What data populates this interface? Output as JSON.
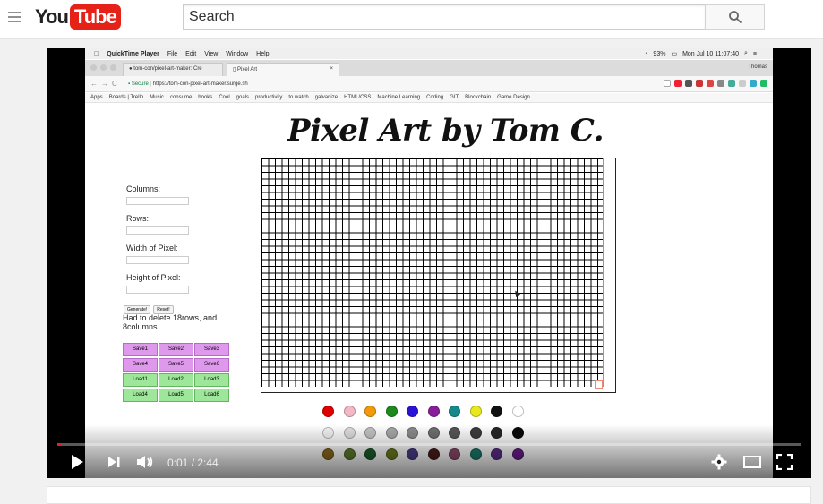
{
  "masthead": {
    "logo_you": "You",
    "logo_tube": "Tube",
    "search_placeholder": "Search"
  },
  "video": {
    "mac_menubar": {
      "app": "QuickTime Player",
      "items": [
        "File",
        "Edit",
        "View",
        "Window",
        "Help"
      ],
      "battery": "93%",
      "clock": "Mon Jul 10  11:07:40"
    },
    "browser": {
      "tab1": "tom-con/pixel-art-maker: Cre",
      "tab2": "Pixel Art",
      "user": "Thomas",
      "secure_label": "Secure",
      "url": "https://tom-con-pixel-art-maker.surge.sh",
      "bookmarks": [
        "Apps",
        "Boards | Trello",
        "Music",
        "consume",
        "books",
        "Cool",
        "goals",
        "productivity",
        "to watch",
        "galvanize",
        "HTML/CSS",
        "Machine Learning",
        "Coding",
        "GIT",
        "Blockchain",
        "Game Design"
      ]
    },
    "page": {
      "title": "Pixel Art by Tom C.",
      "labels": {
        "columns": "Columns:",
        "rows": "Rows:",
        "width": "Width of Pixel:",
        "height": "Height of Pixel:"
      },
      "generate": "Generate!",
      "reset": "Reset!",
      "note": "Had to delete 18rows, and 8columns.",
      "save_buttons": [
        "Save1",
        "Save2",
        "Save3",
        "Save4",
        "Save5",
        "Save6"
      ],
      "load_buttons": [
        "Load1",
        "Load2",
        "Load3",
        "Load4",
        "Load5",
        "Load6"
      ],
      "palette": [
        "#e00000",
        "#f2b8c6",
        "#f29a0c",
        "#1c8a1c",
        "#2a12d8",
        "#8a1c9c",
        "#168a8a",
        "#e8e81a",
        "#111111",
        "#ffffff",
        "#f4f4f4",
        "#e0e0e0",
        "#c4c4c4",
        "#a8a8a8",
        "#8c8c8c",
        "#707070",
        "#575757",
        "#3e3e3e",
        "#262626",
        "#0a0a0a",
        "#8a6a1c",
        "#5c7a2c",
        "#1c5c2c",
        "#6a7a1c",
        "#4a3c8a",
        "#4a1c1c",
        "#8a4a6a",
        "#1c7a6a",
        "#5a2c8a",
        "#6a1c8a"
      ]
    }
  },
  "player": {
    "time_current": "0:01",
    "time_separator": " / ",
    "time_total": "2:44",
    "progress_fraction": 0.006
  }
}
